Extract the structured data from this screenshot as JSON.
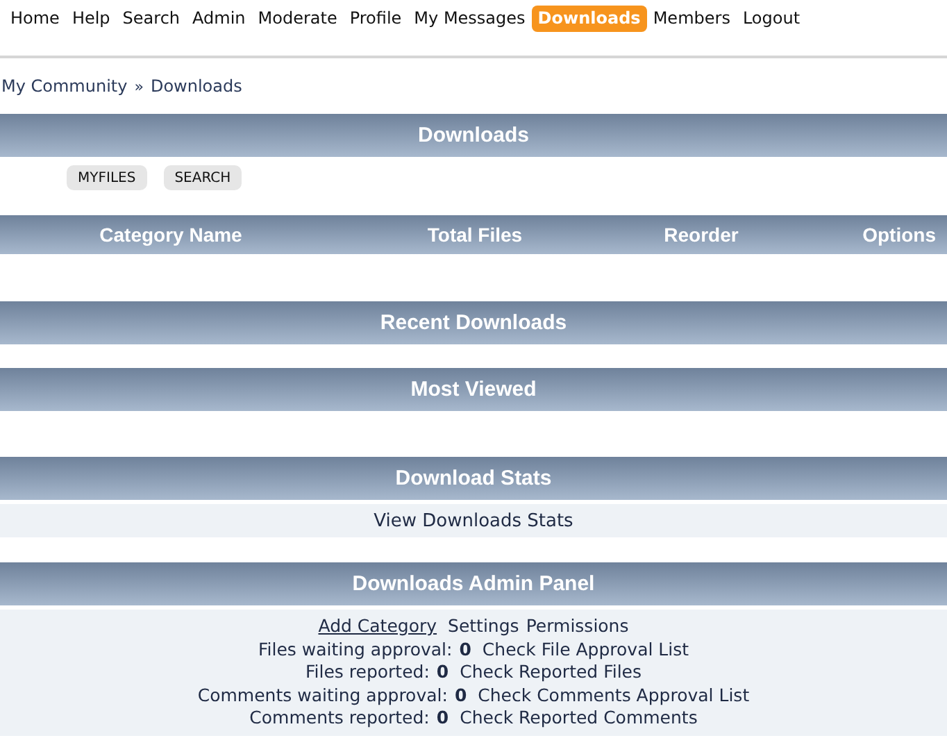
{
  "nav": [
    {
      "label": "Home",
      "selected": false
    },
    {
      "label": "Help",
      "selected": false
    },
    {
      "label": "Search",
      "selected": false
    },
    {
      "label": "Admin",
      "selected": false
    },
    {
      "label": "Moderate",
      "selected": false
    },
    {
      "label": "Profile",
      "selected": false
    },
    {
      "label": "My Messages",
      "selected": false
    },
    {
      "label": "Downloads",
      "selected": true
    },
    {
      "label": "Members",
      "selected": false
    },
    {
      "label": "Logout",
      "selected": false
    }
  ],
  "breadcrumb": {
    "items": [
      "My Community",
      "Downloads"
    ],
    "separator": "»"
  },
  "downloads": {
    "title": "Downloads",
    "buttons": [
      "MYFILES",
      "SEARCH"
    ]
  },
  "categories_table": {
    "columns": [
      "Category Name",
      "Total Files",
      "Reorder",
      "Options"
    ]
  },
  "recent_downloads": {
    "title": "Recent Downloads"
  },
  "most_viewed": {
    "title": "Most Viewed"
  },
  "download_stats": {
    "title": "Download Stats",
    "link": "View Downloads Stats"
  },
  "admin_panel": {
    "title": "Downloads Admin Panel",
    "links": [
      {
        "label": "Add Category",
        "underlined": true
      },
      {
        "label": "Settings",
        "underlined": false
      },
      {
        "label": "Permissions",
        "underlined": false
      }
    ],
    "stats": [
      {
        "label": "Files waiting approval:",
        "count": "0",
        "link": "Check File Approval List"
      },
      {
        "label": "Files reported:",
        "count": "0",
        "link": "Check Reported Files"
      },
      {
        "label": "Comments waiting approval:",
        "count": "0",
        "link": "Check Comments Approval List"
      },
      {
        "label": "Comments reported:",
        "count": "0",
        "link": "Check Reported Comments"
      }
    ]
  }
}
